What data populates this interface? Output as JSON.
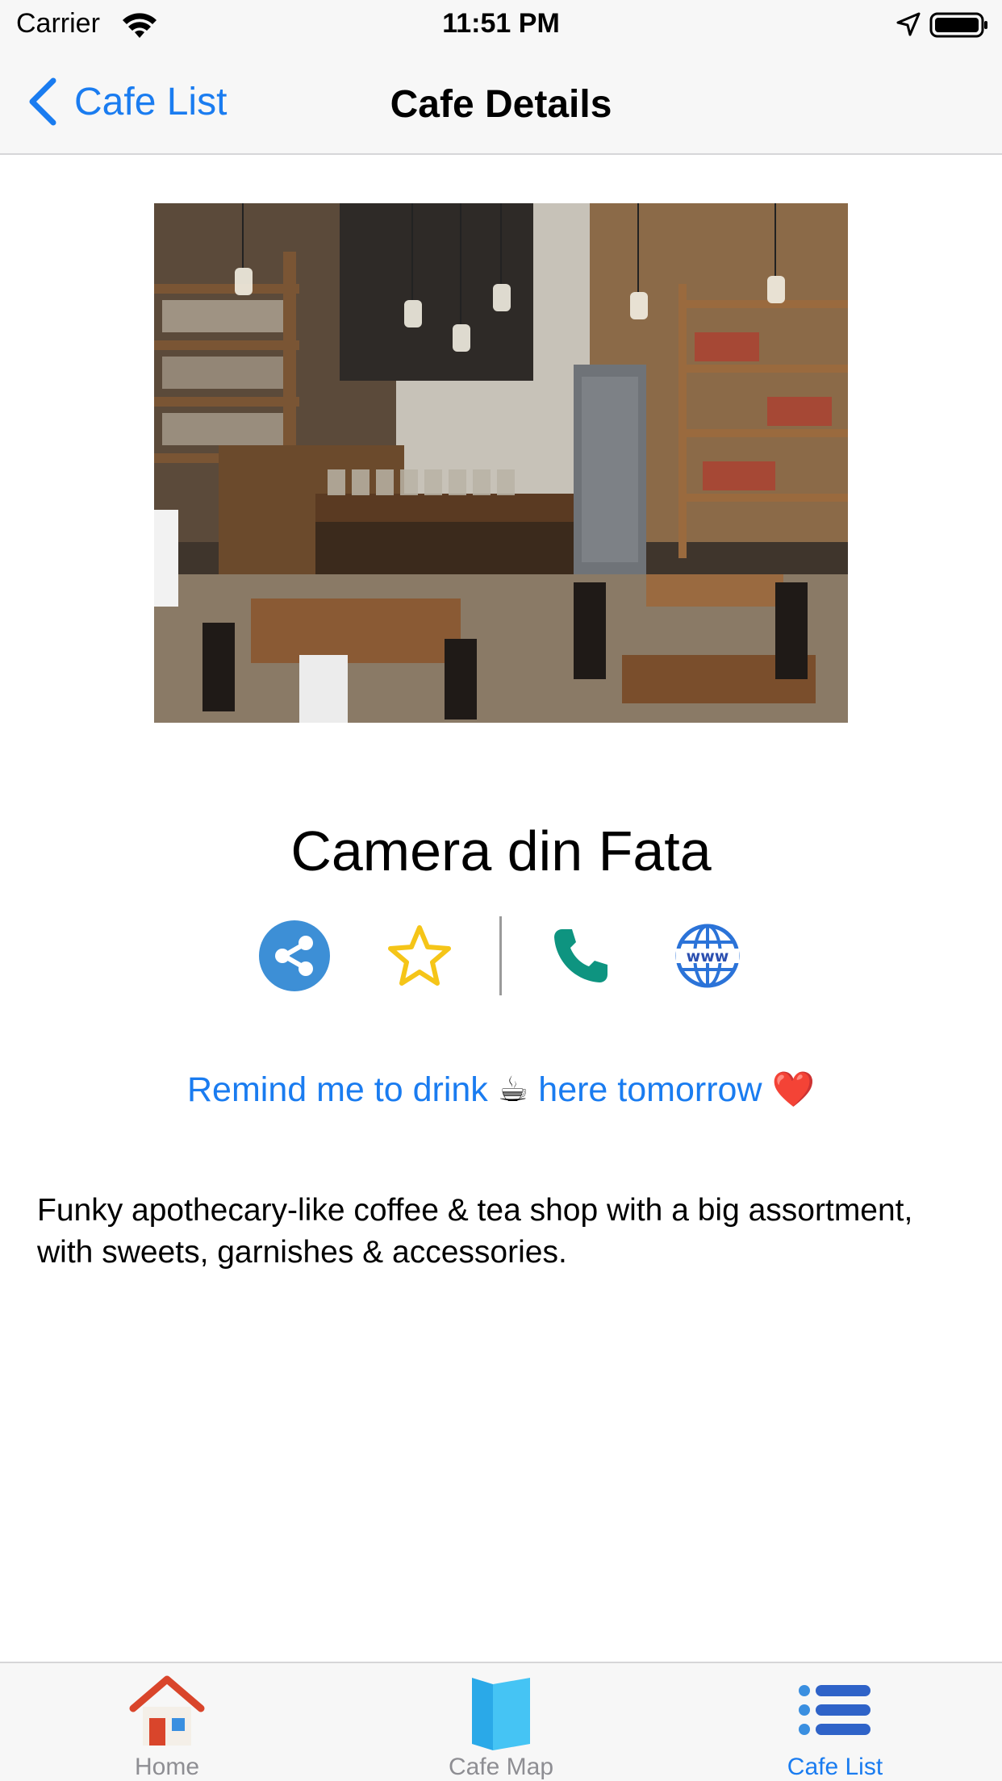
{
  "status_bar": {
    "carrier": "Carrier",
    "time": "11:51 PM",
    "icons": [
      "wifi-icon",
      "location-arrow-icon",
      "battery-icon"
    ]
  },
  "nav": {
    "back_label": "Cafe List",
    "title": "Cafe Details"
  },
  "cafe": {
    "name": "Camera din Fata",
    "remind_part1": "Remind me to drink",
    "remind_emoji1": "☕",
    "remind_part2": "here tomorrow",
    "remind_emoji2": "❤️",
    "description": "Funky apothecary-like coffee & tea shop with a big assortment, with sweets, garnishes & accessories."
  },
  "actions": [
    {
      "icon": "share-icon",
      "color": "#3d8fd6"
    },
    {
      "icon": "star-icon",
      "color": "#f5c518"
    },
    {
      "icon": "phone-icon",
      "color": "#0e9480"
    },
    {
      "icon": "www-globe-icon",
      "color": "#1f6fd6"
    }
  ],
  "tabs": [
    {
      "label": "Home",
      "icon": "home-icon"
    },
    {
      "label": "Cafe Map",
      "icon": "map-icon"
    },
    {
      "label": "Cafe List",
      "icon": "list-icon"
    }
  ],
  "colors": {
    "accent": "#1a7cf0",
    "inactive_tab": "#8e8e93",
    "bar_background": "#f7f7f7"
  }
}
